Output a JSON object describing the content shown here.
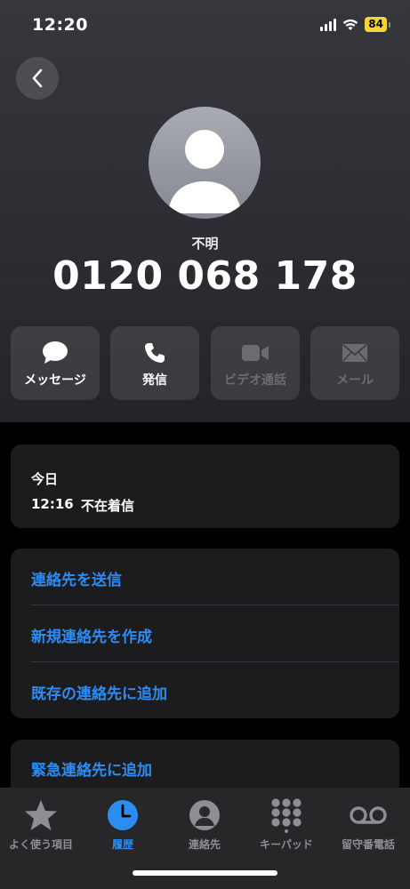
{
  "status": {
    "time": "12:20",
    "battery": "84"
  },
  "contact": {
    "label": "不明",
    "number": "0120 068 178"
  },
  "actions": [
    {
      "label": "メッセージ",
      "icon": "message-icon",
      "enabled": true
    },
    {
      "label": "発信",
      "icon": "phone-icon",
      "enabled": true
    },
    {
      "label": "ビデオ通話",
      "icon": "video-icon",
      "enabled": false
    },
    {
      "label": "メール",
      "icon": "mail-icon",
      "enabled": false
    }
  ],
  "recent": {
    "title": "今日",
    "time": "12:16",
    "type": "不在着信"
  },
  "options": [
    {
      "label": "連絡先を送信"
    },
    {
      "label": "新規連絡先を作成"
    },
    {
      "label": "既存の連絡先に追加"
    }
  ],
  "emergency": {
    "label": "緊急連絡先に追加"
  },
  "tabs": [
    {
      "label": "よく使う項目",
      "icon": "star-icon",
      "active": false
    },
    {
      "label": "履歴",
      "icon": "clock-icon",
      "active": true
    },
    {
      "label": "連絡先",
      "icon": "person-icon",
      "active": false
    },
    {
      "label": "キーパッド",
      "icon": "keypad-icon",
      "active": false
    },
    {
      "label": "留守番電話",
      "icon": "voicemail-icon",
      "active": false
    }
  ],
  "colors": {
    "accent": "#2d8cf2",
    "battery": "#f7d436",
    "card": "#1c1c1e"
  }
}
